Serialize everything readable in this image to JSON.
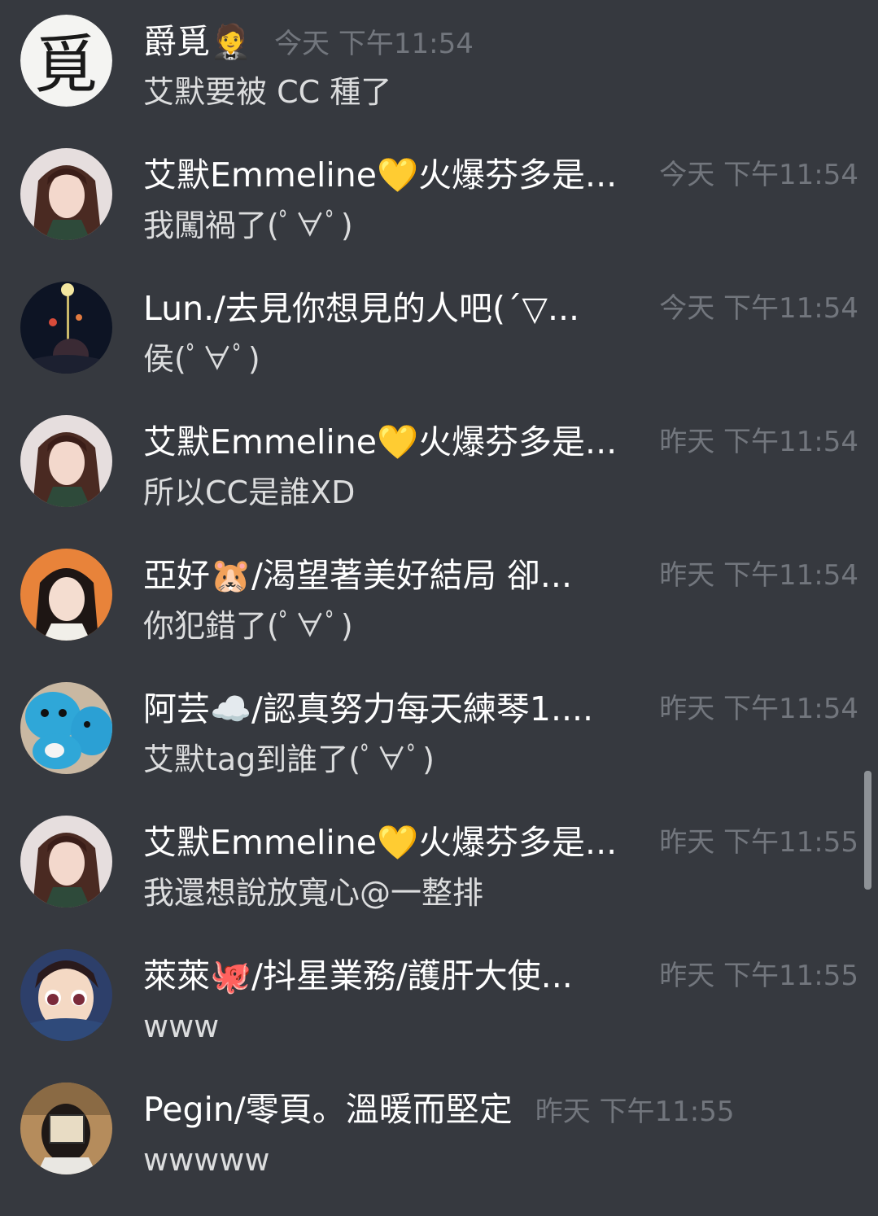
{
  "messages": [
    {
      "user": "爵覓🤵",
      "time": "今天 下午11:54",
      "text": "艾默要被 CC 種了"
    },
    {
      "user": "艾默Emmeline💛火爆芬多是...",
      "time": "今天 下午11:54",
      "text": "我闖禍了(ﾟ∀ﾟ)"
    },
    {
      "user": "Lun./去見你想見的人吧(´▽...",
      "time": "今天 下午11:54",
      "text": "侯(ﾟ∀ﾟ)"
    },
    {
      "user": "艾默Emmeline💛火爆芬多是...",
      "time": "昨天 下午11:54",
      "text": "所以CC是誰XD"
    },
    {
      "user": "亞好🐹/渴望著美好結局 卻...",
      "time": "昨天 下午11:54",
      "text": "你犯錯了(ﾟ∀ﾟ)"
    },
    {
      "user": "阿芸☁️/認真努力每天練琴1....",
      "time": "昨天 下午11:54",
      "text": "艾默tag到誰了(ﾟ∀ﾟ)"
    },
    {
      "user": "艾默Emmeline💛火爆芬多是...",
      "time": "昨天 下午11:55",
      "text": "我還想說放寬心@一整排"
    },
    {
      "user": "萊萊🐙/抖星業務/護肝大使...",
      "time": "昨天 下午11:55",
      "text": "www"
    },
    {
      "user": "Pegin/零頁。溫暖而堅定",
      "time": "昨天 下午11:55",
      "text": "wwwww"
    }
  ],
  "avatars": [
    "覓",
    "",
    "",
    "",
    "",
    "",
    "",
    "",
    ""
  ],
  "colors": {
    "background": "#36393f",
    "username": "#ffffff",
    "timestamp": "#72767d",
    "message": "#dcddde"
  }
}
